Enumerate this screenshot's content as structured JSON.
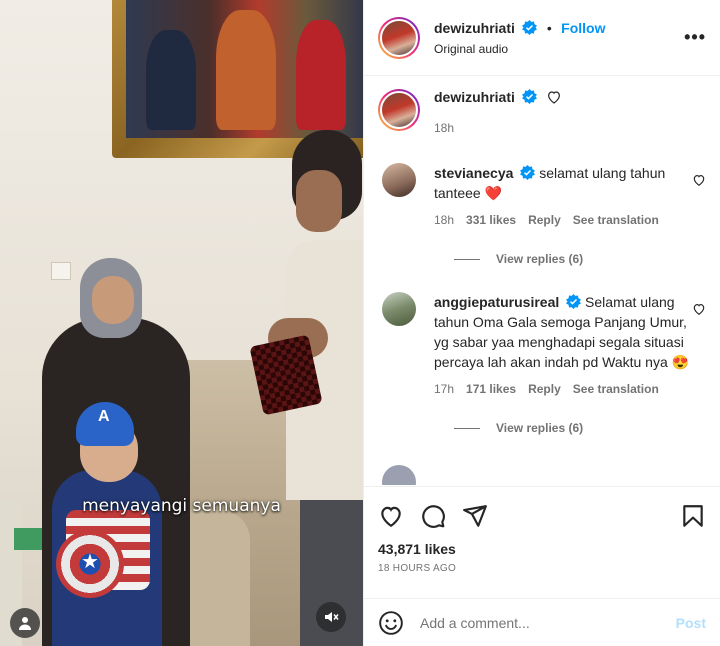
{
  "header": {
    "username": "dewizuhriati",
    "separator": "•",
    "follow_label": "Follow",
    "subtitle": "Original audio",
    "more_icon": "more-horizontal-icon",
    "more_label": "•••"
  },
  "video": {
    "caption": "menyayangi semuanya",
    "shield_star": "★",
    "helmet_letter": "A",
    "mute_icon": "speaker-muted-icon",
    "user_icon": "person-icon"
  },
  "post_caption": {
    "username": "dewizuhriati",
    "time": "18h"
  },
  "comments": [
    {
      "username": "stevianecya",
      "text": "selamat ulang tahun tanteee ❤️",
      "time": "18h",
      "likes": "331 likes",
      "reply": "Reply",
      "translate": "See translation",
      "view_replies": "View replies (6)"
    },
    {
      "username": "anggiepaturusireal",
      "text": "Selamat ulang tahun Oma Gala semoga Panjang Umur, yg sabar yaa menghadapi segala situasi percaya lah akan indah pd Waktu nya 😍",
      "time": "17h",
      "likes": "171 likes",
      "reply": "Reply",
      "translate": "See translation",
      "view_replies": "View replies (6)"
    }
  ],
  "actions": {
    "likes": "43,871 likes",
    "ago": "18 HOURS AGO"
  },
  "add_comment": {
    "placeholder": "Add a comment...",
    "post_label": "Post"
  },
  "colors": {
    "accent": "#0095f6",
    "verified": "#0095f6",
    "muted_text": "#737373"
  }
}
